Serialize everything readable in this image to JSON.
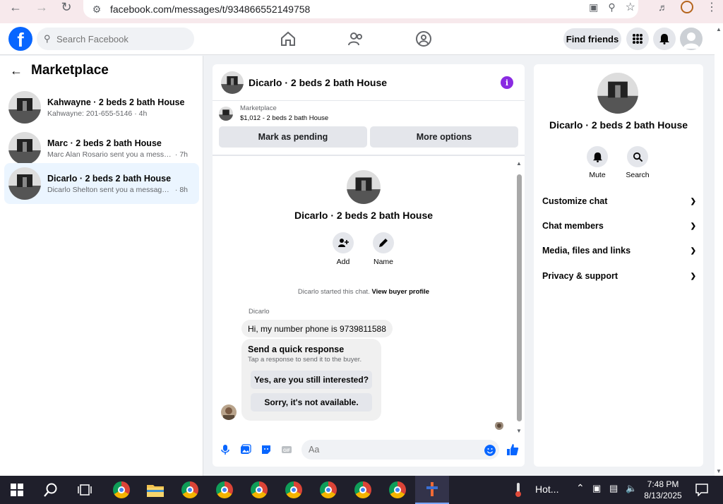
{
  "browser": {
    "url": "facebook.com/messages/t/934866552149758"
  },
  "fb": {
    "search_placeholder": "Search Facebook",
    "find_friends": "Find friends"
  },
  "left": {
    "title": "Marketplace",
    "conversations": [
      {
        "name": "Kahwayne · 2 beds 2 bath House",
        "preview": "Kahwayne: 201-655-5146",
        "time": "· 4h"
      },
      {
        "name": "Marc · 2 beds 2 bath House",
        "preview": "Marc Alan Rosario sent you a messag...",
        "time": "· 7h"
      },
      {
        "name": "Dicarlo · 2 beds 2 bath House",
        "preview": "Dicarlo Shelton sent you a message a...",
        "time": "· 8h"
      }
    ]
  },
  "chat": {
    "title": "Dicarlo · 2 beds 2 bath House",
    "marketplace_label": "Marketplace",
    "listing": "$1,012 - 2 beds 2 bath House",
    "mark_pending": "Mark as pending",
    "more_options": "More options",
    "body_title": "Dicarlo · 2 beds 2 bath House",
    "add_label": "Add",
    "name_label": "Name",
    "started_text": "Dicarlo started this chat.",
    "view_buyer": "View buyer profile",
    "sender": "Dicarlo",
    "message": "Hi, my number phone is 9739811588",
    "quick_title": "Send a quick response",
    "quick_sub": "Tap a response to send it to the buyer.",
    "quick_1": "Yes, are you still interested?",
    "quick_2": "Sorry, it's not available.",
    "input_placeholder": "Aa"
  },
  "right": {
    "title": "Dicarlo · 2 beds 2 bath House",
    "mute": "Mute",
    "search": "Search",
    "rows": [
      "Customize chat",
      "Chat members",
      "Media, files and links",
      "Privacy & support"
    ]
  },
  "taskbar": {
    "weather": "Hot...",
    "time": "7:48 PM",
    "date": "8/13/2025"
  },
  "colors": {
    "fb_blue": "#0866ff",
    "active_row": "#ebf5ff",
    "info_purple": "#8a2be2"
  }
}
